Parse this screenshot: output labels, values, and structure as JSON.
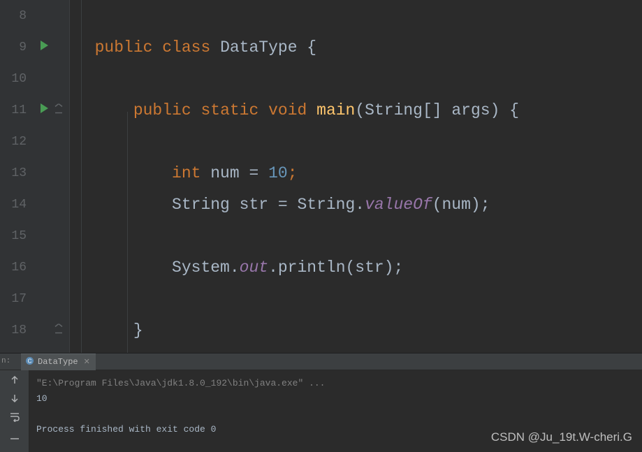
{
  "lines": [
    {
      "n": 8,
      "run": false,
      "fold": false
    },
    {
      "n": 9,
      "run": true,
      "fold": false
    },
    {
      "n": 10,
      "run": false,
      "fold": false
    },
    {
      "n": 11,
      "run": true,
      "fold": true
    },
    {
      "n": 12,
      "run": false,
      "fold": false
    },
    {
      "n": 13,
      "run": false,
      "fold": false
    },
    {
      "n": 14,
      "run": false,
      "fold": false
    },
    {
      "n": 15,
      "run": false,
      "fold": false
    },
    {
      "n": 16,
      "run": false,
      "fold": false
    },
    {
      "n": 17,
      "run": false,
      "fold": false
    },
    {
      "n": 18,
      "run": false,
      "fold": true
    }
  ],
  "code": {
    "l9": {
      "pre": "  ",
      "kw1": "public",
      "sp1": " ",
      "kw2": "class",
      "sp2": " ",
      "cls": "DataType",
      "brace": " {"
    },
    "l11": {
      "pre": "      ",
      "kw1": "public",
      "sp1": " ",
      "kw2": "static",
      "sp2": " ",
      "kw3": "void",
      "sp3": " ",
      "m": "main",
      "args": "(String[] args) {"
    },
    "l13": {
      "pre": "          ",
      "kw": "int",
      "rest": " num = ",
      "num": "10",
      "semi": ";"
    },
    "l14": {
      "pre": "          ",
      "txt1": "String str = String.",
      "fld": "valueOf",
      "txt2": "(num);"
    },
    "l16": {
      "pre": "          ",
      "txt1": "System.",
      "fld": "out",
      "txt2": ".println(str);"
    },
    "l18": {
      "pre": "      ",
      "brace": "}"
    }
  },
  "tab": {
    "label": "DataType"
  },
  "console": {
    "cmd": "\"E:\\Program Files\\Java\\jdk1.8.0_192\\bin\\java.exe\" ...",
    "out": "10",
    "exit": "Process finished with exit code 0"
  },
  "panel": {
    "left_hint": "n:"
  },
  "watermark": "CSDN @Ju_19t.W-cheri.G"
}
